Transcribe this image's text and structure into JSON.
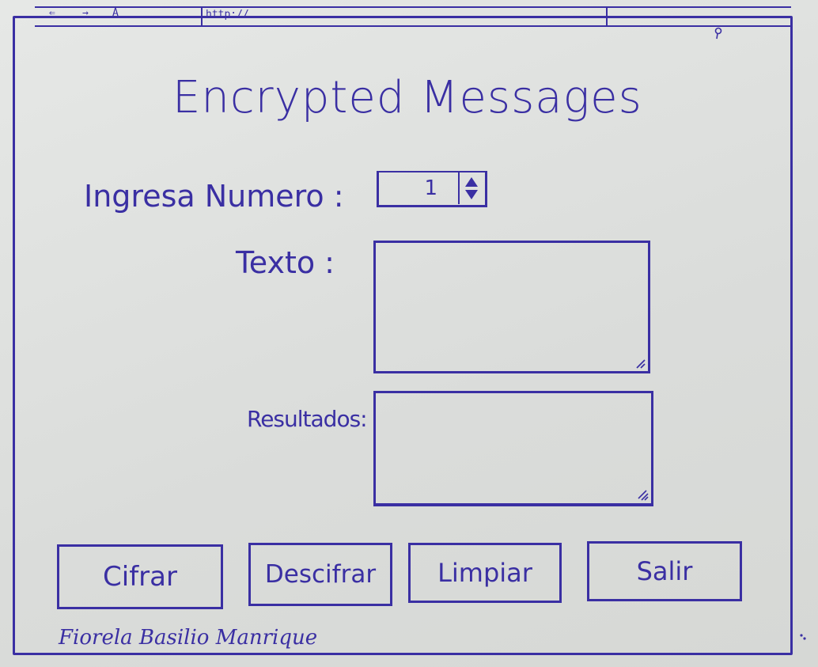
{
  "browser": {
    "back_label": "⇐",
    "forward_label": "→",
    "lock_label": "A",
    "url": "http://",
    "search_icon": "search-icon"
  },
  "app": {
    "title": "Encrypted Messages"
  },
  "form": {
    "numero_label": "Ingresa Numero :",
    "numero_value": "1",
    "texto_label": "Texto :",
    "texto_value": "",
    "resultados_label": "Resultados:",
    "resultados_value": ""
  },
  "buttons": {
    "cifrar": "Cifrar",
    "descifrar": "Descifrar",
    "limpiar": "Limpiar",
    "salir": "Salir"
  },
  "footer": {
    "author": "Fiorela Basilio Manrique"
  },
  "colors": {
    "ink": "#3a2fa3",
    "paper": "#dfe1df"
  }
}
